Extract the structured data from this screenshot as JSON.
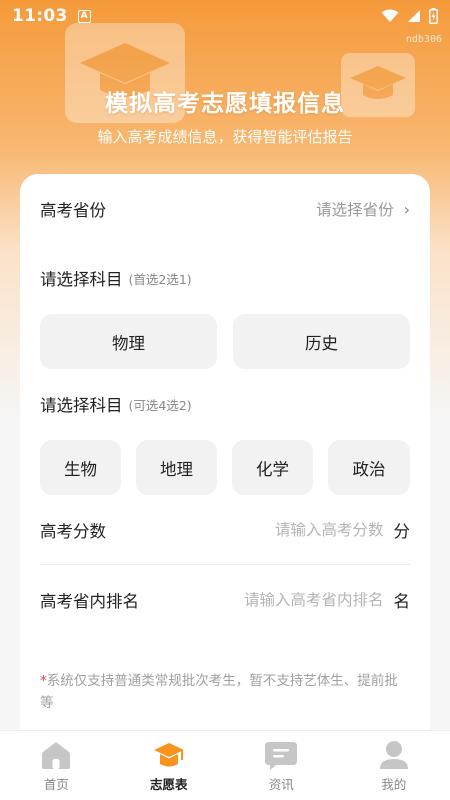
{
  "status_bar": {
    "time": "11:03",
    "app_badge": "A"
  },
  "watermark": "ndb306",
  "header": {
    "title": "模拟高考志愿填报信息",
    "subtitle": "输入高考成绩信息，获得智能评估报告"
  },
  "form": {
    "province": {
      "label": "高考省份",
      "placeholder": "请选择省份"
    },
    "primary_subject": {
      "title": "请选择科目",
      "hint": "(首选2选1)",
      "options": [
        "物理",
        "历史"
      ]
    },
    "secondary_subject": {
      "title": "请选择科目",
      "hint": "(可选4选2)",
      "options": [
        "生物",
        "地理",
        "化学",
        "政治"
      ]
    },
    "score": {
      "label": "高考分数",
      "placeholder": "请输入高考分数",
      "unit": "分"
    },
    "rank": {
      "label": "高考省内排名",
      "placeholder": "请输入高考省内排名",
      "unit": "名"
    },
    "notice_mark": "*",
    "notice": "系统仅支持普通类常规批次考生，暂不支持艺体生、提前批等"
  },
  "tabbar": {
    "items": [
      {
        "label": "首页",
        "icon": "home-icon"
      },
      {
        "label": "志愿表",
        "icon": "graduation-cap-icon",
        "active": true
      },
      {
        "label": "资讯",
        "icon": "message-icon"
      },
      {
        "label": "我的",
        "icon": "user-icon"
      }
    ]
  },
  "colors": {
    "accent": "#f7931e",
    "background": "#f6f6f6",
    "warning": "#e53935"
  }
}
